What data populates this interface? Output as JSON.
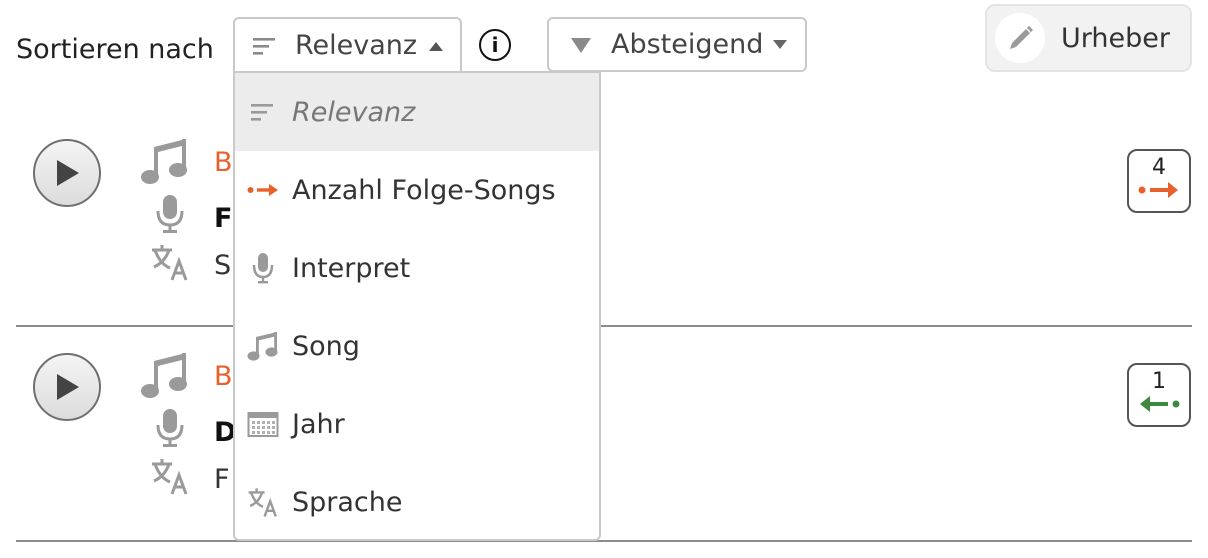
{
  "toolbar": {
    "sort_label": "Sortieren nach",
    "sort_selected": "Relevanz",
    "info_label": "i",
    "order_selected": "Absteigend",
    "author_label": "Urheber"
  },
  "rows": [
    {
      "song_fragment": "B",
      "artist_fragment": "F",
      "language_fragment": "S",
      "badge_count": "4",
      "badge_direction": "forward"
    },
    {
      "song_fragment": "B",
      "artist_fragment": "D",
      "language_fragment": "F",
      "badge_count": "1",
      "badge_direction": "backward"
    }
  ],
  "dropdown": {
    "items": [
      {
        "label": "Relevanz",
        "icon": "sort-lines-icon",
        "selected": true
      },
      {
        "label": "Anzahl Folge-Songs",
        "icon": "dot-arrow-right-icon",
        "selected": false
      },
      {
        "label": "Interpret",
        "icon": "microphone-icon",
        "selected": false
      },
      {
        "label": "Song",
        "icon": "music-note-icon",
        "selected": false
      },
      {
        "label": "Jahr",
        "icon": "calendar-icon",
        "selected": false
      },
      {
        "label": "Sprache",
        "icon": "translate-icon",
        "selected": false
      }
    ]
  },
  "colors": {
    "accent_orange": "#e8612c",
    "accent_green": "#3d8a3d",
    "icon_gray": "#9a9a9a",
    "border_gray": "#c9c9c9"
  }
}
